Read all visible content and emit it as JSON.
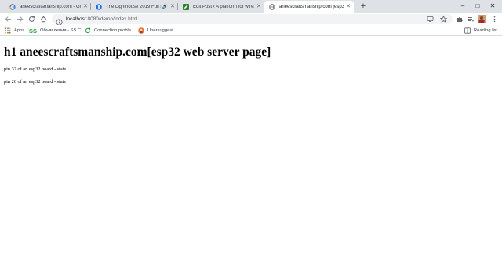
{
  "browser": {
    "tabs": [
      {
        "title": "aneescraftsmanship.com - Goog",
        "favicon": "google-g-icon",
        "active": false
      },
      {
        "title": "The Lighthouse 2019 Full m",
        "favicon": "lighthouse-icon",
        "active": false,
        "audio_icon": "speaker-icon"
      },
      {
        "title": "Edit Post ‹ A platform for wireles",
        "favicon": "edit-post-icon",
        "active": false
      },
      {
        "title": "aneescraftsmanship.com [esp32",
        "favicon": "globe-icon",
        "active": true
      }
    ],
    "new_tab_label": "+",
    "window_controls": {
      "minimize": "–",
      "maximize": "□",
      "close": "✕"
    },
    "toolbar": {
      "url_host": "localhost",
      "url_rest": ":8080/demo/index.html",
      "reading_list_label": "Reading list"
    },
    "bookmarks": [
      {
        "label": "Apps",
        "icon": "apps-grid-icon"
      },
      {
        "label": "Объявления - SS.C...",
        "icon": "ss-logo-icon"
      },
      {
        "label": "Connection proble...",
        "icon": "refresh-leaf-icon"
      },
      {
        "label": "Ubersuggest",
        "icon": "ubersuggest-icon"
      }
    ],
    "colors": {
      "tabstrip": "#dee1e6",
      "active_tab": "#ffffff",
      "omnibox": "#f1f3f4",
      "ss_green": "#2e9c3a"
    }
  },
  "page": {
    "heading": "h1 aneescraftsmanship.com[esp32 web server page]",
    "paragraphs": [
      "pin 32 of an esp32 board - state",
      "pin 26 of an esp32 board - state"
    ]
  }
}
